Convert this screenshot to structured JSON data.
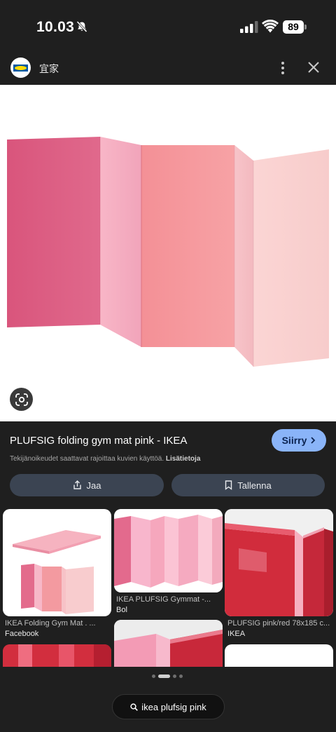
{
  "status_bar": {
    "time": "10.03",
    "battery": "89"
  },
  "header": {
    "site_name": "宜家"
  },
  "hero": {
    "description_icon": "google-lens-icon"
  },
  "result": {
    "title": "PLUFSIG folding gym mat pink - IKEA",
    "visit_label": "Siirry",
    "copyright_text": "Tekijänoikeudet saattavat rajoittaa kuvien käyttöä.",
    "learn_more": "Lisätietoja",
    "share_label": "Jaa",
    "save_label": "Tallenna"
  },
  "related": [
    {
      "caption": "IKEA Folding Gym Mat . ...",
      "source": "Facebook"
    },
    {
      "caption": "IKEA PLUFSIG Gymmat -...",
      "source": "Bol"
    },
    {
      "caption": "PLUFSIG pink/red 78x185 c...",
      "source": "IKEA"
    }
  ],
  "bottom": {
    "search_query": "ikea plufsig pink"
  },
  "colors": {
    "accent": "#8ab4f8",
    "background": "#1f1f1f",
    "mat_pink": "#f2a8b8",
    "mat_red": "#c8283a"
  }
}
